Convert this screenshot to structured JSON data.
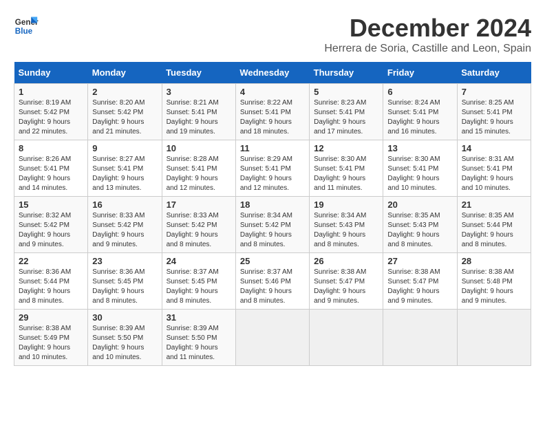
{
  "logo": {
    "line1": "General",
    "line2": "Blue"
  },
  "title": "December 2024",
  "subtitle": "Herrera de Soria, Castille and Leon, Spain",
  "days_header": [
    "Sunday",
    "Monday",
    "Tuesday",
    "Wednesday",
    "Thursday",
    "Friday",
    "Saturday"
  ],
  "weeks": [
    [
      {
        "day": "1",
        "sunrise": "Sunrise: 8:19 AM",
        "sunset": "Sunset: 5:42 PM",
        "daylight": "Daylight: 9 hours and 22 minutes."
      },
      {
        "day": "2",
        "sunrise": "Sunrise: 8:20 AM",
        "sunset": "Sunset: 5:42 PM",
        "daylight": "Daylight: 9 hours and 21 minutes."
      },
      {
        "day": "3",
        "sunrise": "Sunrise: 8:21 AM",
        "sunset": "Sunset: 5:41 PM",
        "daylight": "Daylight: 9 hours and 19 minutes."
      },
      {
        "day": "4",
        "sunrise": "Sunrise: 8:22 AM",
        "sunset": "Sunset: 5:41 PM",
        "daylight": "Daylight: 9 hours and 18 minutes."
      },
      {
        "day": "5",
        "sunrise": "Sunrise: 8:23 AM",
        "sunset": "Sunset: 5:41 PM",
        "daylight": "Daylight: 9 hours and 17 minutes."
      },
      {
        "day": "6",
        "sunrise": "Sunrise: 8:24 AM",
        "sunset": "Sunset: 5:41 PM",
        "daylight": "Daylight: 9 hours and 16 minutes."
      },
      {
        "day": "7",
        "sunrise": "Sunrise: 8:25 AM",
        "sunset": "Sunset: 5:41 PM",
        "daylight": "Daylight: 9 hours and 15 minutes."
      }
    ],
    [
      {
        "day": "8",
        "sunrise": "Sunrise: 8:26 AM",
        "sunset": "Sunset: 5:41 PM",
        "daylight": "Daylight: 9 hours and 14 minutes."
      },
      {
        "day": "9",
        "sunrise": "Sunrise: 8:27 AM",
        "sunset": "Sunset: 5:41 PM",
        "daylight": "Daylight: 9 hours and 13 minutes."
      },
      {
        "day": "10",
        "sunrise": "Sunrise: 8:28 AM",
        "sunset": "Sunset: 5:41 PM",
        "daylight": "Daylight: 9 hours and 12 minutes."
      },
      {
        "day": "11",
        "sunrise": "Sunrise: 8:29 AM",
        "sunset": "Sunset: 5:41 PM",
        "daylight": "Daylight: 9 hours and 12 minutes."
      },
      {
        "day": "12",
        "sunrise": "Sunrise: 8:30 AM",
        "sunset": "Sunset: 5:41 PM",
        "daylight": "Daylight: 9 hours and 11 minutes."
      },
      {
        "day": "13",
        "sunrise": "Sunrise: 8:30 AM",
        "sunset": "Sunset: 5:41 PM",
        "daylight": "Daylight: 9 hours and 10 minutes."
      },
      {
        "day": "14",
        "sunrise": "Sunrise: 8:31 AM",
        "sunset": "Sunset: 5:41 PM",
        "daylight": "Daylight: 9 hours and 10 minutes."
      }
    ],
    [
      {
        "day": "15",
        "sunrise": "Sunrise: 8:32 AM",
        "sunset": "Sunset: 5:42 PM",
        "daylight": "Daylight: 9 hours and 9 minutes."
      },
      {
        "day": "16",
        "sunrise": "Sunrise: 8:33 AM",
        "sunset": "Sunset: 5:42 PM",
        "daylight": "Daylight: 9 hours and 9 minutes."
      },
      {
        "day": "17",
        "sunrise": "Sunrise: 8:33 AM",
        "sunset": "Sunset: 5:42 PM",
        "daylight": "Daylight: 9 hours and 8 minutes."
      },
      {
        "day": "18",
        "sunrise": "Sunrise: 8:34 AM",
        "sunset": "Sunset: 5:42 PM",
        "daylight": "Daylight: 9 hours and 8 minutes."
      },
      {
        "day": "19",
        "sunrise": "Sunrise: 8:34 AM",
        "sunset": "Sunset: 5:43 PM",
        "daylight": "Daylight: 9 hours and 8 minutes."
      },
      {
        "day": "20",
        "sunrise": "Sunrise: 8:35 AM",
        "sunset": "Sunset: 5:43 PM",
        "daylight": "Daylight: 9 hours and 8 minutes."
      },
      {
        "day": "21",
        "sunrise": "Sunrise: 8:35 AM",
        "sunset": "Sunset: 5:44 PM",
        "daylight": "Daylight: 9 hours and 8 minutes."
      }
    ],
    [
      {
        "day": "22",
        "sunrise": "Sunrise: 8:36 AM",
        "sunset": "Sunset: 5:44 PM",
        "daylight": "Daylight: 9 hours and 8 minutes."
      },
      {
        "day": "23",
        "sunrise": "Sunrise: 8:36 AM",
        "sunset": "Sunset: 5:45 PM",
        "daylight": "Daylight: 9 hours and 8 minutes."
      },
      {
        "day": "24",
        "sunrise": "Sunrise: 8:37 AM",
        "sunset": "Sunset: 5:45 PM",
        "daylight": "Daylight: 9 hours and 8 minutes."
      },
      {
        "day": "25",
        "sunrise": "Sunrise: 8:37 AM",
        "sunset": "Sunset: 5:46 PM",
        "daylight": "Daylight: 9 hours and 8 minutes."
      },
      {
        "day": "26",
        "sunrise": "Sunrise: 8:38 AM",
        "sunset": "Sunset: 5:47 PM",
        "daylight": "Daylight: 9 hours and 9 minutes."
      },
      {
        "day": "27",
        "sunrise": "Sunrise: 8:38 AM",
        "sunset": "Sunset: 5:47 PM",
        "daylight": "Daylight: 9 hours and 9 minutes."
      },
      {
        "day": "28",
        "sunrise": "Sunrise: 8:38 AM",
        "sunset": "Sunset: 5:48 PM",
        "daylight": "Daylight: 9 hours and 9 minutes."
      }
    ],
    [
      {
        "day": "29",
        "sunrise": "Sunrise: 8:38 AM",
        "sunset": "Sunset: 5:49 PM",
        "daylight": "Daylight: 9 hours and 10 minutes."
      },
      {
        "day": "30",
        "sunrise": "Sunrise: 8:39 AM",
        "sunset": "Sunset: 5:50 PM",
        "daylight": "Daylight: 9 hours and 10 minutes."
      },
      {
        "day": "31",
        "sunrise": "Sunrise: 8:39 AM",
        "sunset": "Sunset: 5:50 PM",
        "daylight": "Daylight: 9 hours and 11 minutes."
      },
      null,
      null,
      null,
      null
    ]
  ]
}
